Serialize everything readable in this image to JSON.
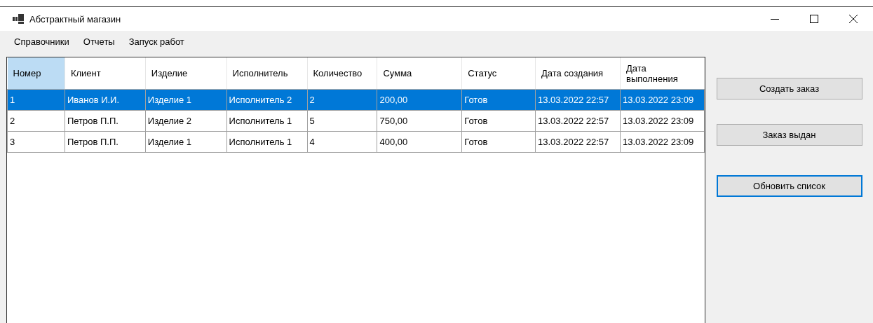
{
  "window": {
    "title": "Абстрактный магазин"
  },
  "menu": [
    {
      "label": "Справочники"
    },
    {
      "label": "Отчеты"
    },
    {
      "label": "Запуск работ"
    }
  ],
  "table": {
    "columns": [
      {
        "label": "Номер",
        "selected": true
      },
      {
        "label": "Клиент",
        "selected": false
      },
      {
        "label": "Изделие",
        "selected": false
      },
      {
        "label": "Исполнитель",
        "selected": false
      },
      {
        "label": "Количество",
        "selected": false
      },
      {
        "label": "Сумма",
        "selected": false
      },
      {
        "label": "Статус",
        "selected": false
      },
      {
        "label": "Дата создания",
        "selected": false
      },
      {
        "label": "Дата выполнения",
        "selected": false
      }
    ],
    "rows": [
      {
        "selected": true,
        "cells": [
          "1",
          "Иванов И.И.",
          "Изделие 1",
          "Исполнитель 2",
          "2",
          "200,00",
          "Готов",
          "13.03.2022 22:57",
          "13.03.2022 23:09"
        ]
      },
      {
        "selected": false,
        "cells": [
          "2",
          "Петров П.П.",
          "Изделие 2",
          "Исполнитель 1",
          "5",
          "750,00",
          "Готов",
          "13.03.2022 22:57",
          "13.03.2022 23:09"
        ]
      },
      {
        "selected": false,
        "cells": [
          "3",
          "Петров П.П.",
          "Изделие 1",
          "Исполнитель 1",
          "4",
          "400,00",
          "Готов",
          "13.03.2022 22:57",
          "13.03.2022 23:09"
        ]
      }
    ]
  },
  "buttons": [
    {
      "label": "Создать заказ",
      "focused": false
    },
    {
      "label": "Заказ выдан",
      "focused": false
    },
    {
      "label": "Обновить список",
      "focused": true
    }
  ]
}
